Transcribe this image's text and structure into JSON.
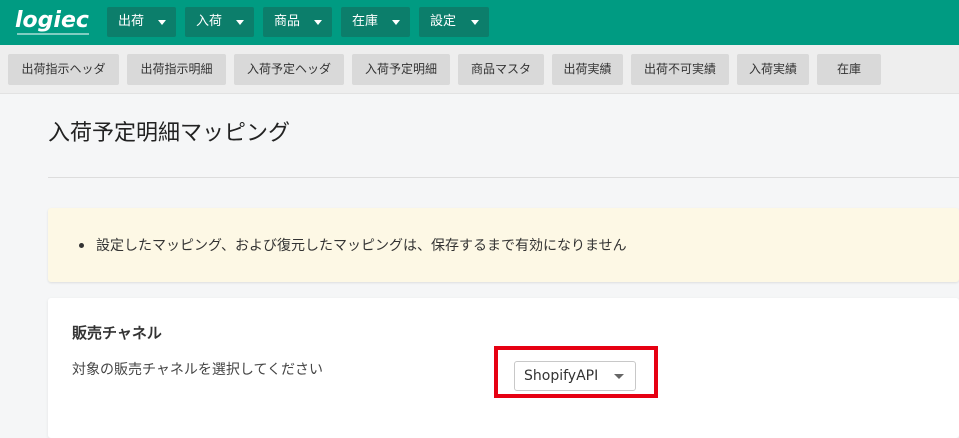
{
  "header": {
    "logo_text": "logiec",
    "nav": [
      {
        "label": "出荷"
      },
      {
        "label": "入荷"
      },
      {
        "label": "商品"
      },
      {
        "label": "在庫"
      },
      {
        "label": "設定"
      }
    ]
  },
  "subnav": [
    {
      "label": "出荷指示ヘッダ"
    },
    {
      "label": "出荷指示明細"
    },
    {
      "label": "入荷予定ヘッダ"
    },
    {
      "label": "入荷予定明細"
    },
    {
      "label": "商品マスタ"
    },
    {
      "label": "出荷実績"
    },
    {
      "label": "出荷不可実績"
    },
    {
      "label": "入荷実績"
    },
    {
      "label": "在庫"
    }
  ],
  "page": {
    "title": "入荷予定明細マッピング"
  },
  "notice": {
    "text": "設定したマッピング、および復元したマッピングは、保存するまで有効になりません"
  },
  "sales_channel": {
    "title": "販売チャネル",
    "description": "対象の販売チャネルを選択してください",
    "selected": "ShopifyAPI"
  },
  "colors": {
    "header_bg": "#009b82",
    "highlight": "#e60012"
  }
}
